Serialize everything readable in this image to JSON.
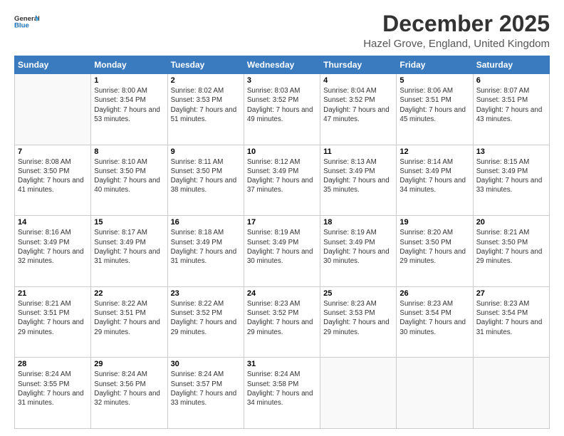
{
  "header": {
    "logo_line1": "General",
    "logo_line2": "Blue",
    "month": "December 2025",
    "location": "Hazel Grove, England, United Kingdom"
  },
  "days_of_week": [
    "Sunday",
    "Monday",
    "Tuesday",
    "Wednesday",
    "Thursday",
    "Friday",
    "Saturday"
  ],
  "weeks": [
    [
      {
        "num": "",
        "sunrise": "",
        "sunset": "",
        "daylight": ""
      },
      {
        "num": "1",
        "sunrise": "Sunrise: 8:00 AM",
        "sunset": "Sunset: 3:54 PM",
        "daylight": "Daylight: 7 hours and 53 minutes."
      },
      {
        "num": "2",
        "sunrise": "Sunrise: 8:02 AM",
        "sunset": "Sunset: 3:53 PM",
        "daylight": "Daylight: 7 hours and 51 minutes."
      },
      {
        "num": "3",
        "sunrise": "Sunrise: 8:03 AM",
        "sunset": "Sunset: 3:52 PM",
        "daylight": "Daylight: 7 hours and 49 minutes."
      },
      {
        "num": "4",
        "sunrise": "Sunrise: 8:04 AM",
        "sunset": "Sunset: 3:52 PM",
        "daylight": "Daylight: 7 hours and 47 minutes."
      },
      {
        "num": "5",
        "sunrise": "Sunrise: 8:06 AM",
        "sunset": "Sunset: 3:51 PM",
        "daylight": "Daylight: 7 hours and 45 minutes."
      },
      {
        "num": "6",
        "sunrise": "Sunrise: 8:07 AM",
        "sunset": "Sunset: 3:51 PM",
        "daylight": "Daylight: 7 hours and 43 minutes."
      }
    ],
    [
      {
        "num": "7",
        "sunrise": "Sunrise: 8:08 AM",
        "sunset": "Sunset: 3:50 PM",
        "daylight": "Daylight: 7 hours and 41 minutes."
      },
      {
        "num": "8",
        "sunrise": "Sunrise: 8:10 AM",
        "sunset": "Sunset: 3:50 PM",
        "daylight": "Daylight: 7 hours and 40 minutes."
      },
      {
        "num": "9",
        "sunrise": "Sunrise: 8:11 AM",
        "sunset": "Sunset: 3:50 PM",
        "daylight": "Daylight: 7 hours and 38 minutes."
      },
      {
        "num": "10",
        "sunrise": "Sunrise: 8:12 AM",
        "sunset": "Sunset: 3:49 PM",
        "daylight": "Daylight: 7 hours and 37 minutes."
      },
      {
        "num": "11",
        "sunrise": "Sunrise: 8:13 AM",
        "sunset": "Sunset: 3:49 PM",
        "daylight": "Daylight: 7 hours and 35 minutes."
      },
      {
        "num": "12",
        "sunrise": "Sunrise: 8:14 AM",
        "sunset": "Sunset: 3:49 PM",
        "daylight": "Daylight: 7 hours and 34 minutes."
      },
      {
        "num": "13",
        "sunrise": "Sunrise: 8:15 AM",
        "sunset": "Sunset: 3:49 PM",
        "daylight": "Daylight: 7 hours and 33 minutes."
      }
    ],
    [
      {
        "num": "14",
        "sunrise": "Sunrise: 8:16 AM",
        "sunset": "Sunset: 3:49 PM",
        "daylight": "Daylight: 7 hours and 32 minutes."
      },
      {
        "num": "15",
        "sunrise": "Sunrise: 8:17 AM",
        "sunset": "Sunset: 3:49 PM",
        "daylight": "Daylight: 7 hours and 31 minutes."
      },
      {
        "num": "16",
        "sunrise": "Sunrise: 8:18 AM",
        "sunset": "Sunset: 3:49 PM",
        "daylight": "Daylight: 7 hours and 31 minutes."
      },
      {
        "num": "17",
        "sunrise": "Sunrise: 8:19 AM",
        "sunset": "Sunset: 3:49 PM",
        "daylight": "Daylight: 7 hours and 30 minutes."
      },
      {
        "num": "18",
        "sunrise": "Sunrise: 8:19 AM",
        "sunset": "Sunset: 3:49 PM",
        "daylight": "Daylight: 7 hours and 30 minutes."
      },
      {
        "num": "19",
        "sunrise": "Sunrise: 8:20 AM",
        "sunset": "Sunset: 3:50 PM",
        "daylight": "Daylight: 7 hours and 29 minutes."
      },
      {
        "num": "20",
        "sunrise": "Sunrise: 8:21 AM",
        "sunset": "Sunset: 3:50 PM",
        "daylight": "Daylight: 7 hours and 29 minutes."
      }
    ],
    [
      {
        "num": "21",
        "sunrise": "Sunrise: 8:21 AM",
        "sunset": "Sunset: 3:51 PM",
        "daylight": "Daylight: 7 hours and 29 minutes."
      },
      {
        "num": "22",
        "sunrise": "Sunrise: 8:22 AM",
        "sunset": "Sunset: 3:51 PM",
        "daylight": "Daylight: 7 hours and 29 minutes."
      },
      {
        "num": "23",
        "sunrise": "Sunrise: 8:22 AM",
        "sunset": "Sunset: 3:52 PM",
        "daylight": "Daylight: 7 hours and 29 minutes."
      },
      {
        "num": "24",
        "sunrise": "Sunrise: 8:23 AM",
        "sunset": "Sunset: 3:52 PM",
        "daylight": "Daylight: 7 hours and 29 minutes."
      },
      {
        "num": "25",
        "sunrise": "Sunrise: 8:23 AM",
        "sunset": "Sunset: 3:53 PM",
        "daylight": "Daylight: 7 hours and 29 minutes."
      },
      {
        "num": "26",
        "sunrise": "Sunrise: 8:23 AM",
        "sunset": "Sunset: 3:54 PM",
        "daylight": "Daylight: 7 hours and 30 minutes."
      },
      {
        "num": "27",
        "sunrise": "Sunrise: 8:23 AM",
        "sunset": "Sunset: 3:54 PM",
        "daylight": "Daylight: 7 hours and 31 minutes."
      }
    ],
    [
      {
        "num": "28",
        "sunrise": "Sunrise: 8:24 AM",
        "sunset": "Sunset: 3:55 PM",
        "daylight": "Daylight: 7 hours and 31 minutes."
      },
      {
        "num": "29",
        "sunrise": "Sunrise: 8:24 AM",
        "sunset": "Sunset: 3:56 PM",
        "daylight": "Daylight: 7 hours and 32 minutes."
      },
      {
        "num": "30",
        "sunrise": "Sunrise: 8:24 AM",
        "sunset": "Sunset: 3:57 PM",
        "daylight": "Daylight: 7 hours and 33 minutes."
      },
      {
        "num": "31",
        "sunrise": "Sunrise: 8:24 AM",
        "sunset": "Sunset: 3:58 PM",
        "daylight": "Daylight: 7 hours and 34 minutes."
      },
      {
        "num": "",
        "sunrise": "",
        "sunset": "",
        "daylight": ""
      },
      {
        "num": "",
        "sunrise": "",
        "sunset": "",
        "daylight": ""
      },
      {
        "num": "",
        "sunrise": "",
        "sunset": "",
        "daylight": ""
      }
    ]
  ]
}
